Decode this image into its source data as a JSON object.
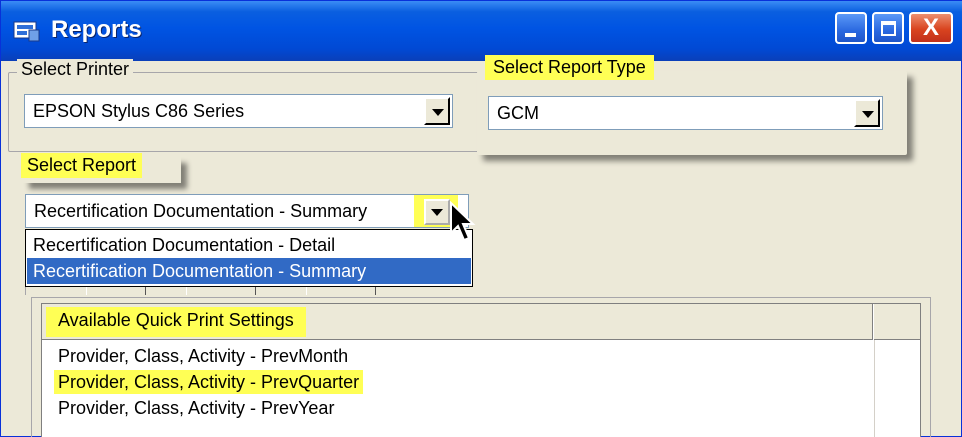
{
  "window": {
    "title": "Reports",
    "close_glyph": "X"
  },
  "printer": {
    "label": "Select Printer",
    "value": "EPSON Stylus C86 Series"
  },
  "report_type": {
    "label": "Select Report Type",
    "value": "GCM"
  },
  "report": {
    "label": "Select Report",
    "value": "Recertification Documentation - Summary",
    "options": [
      "Recertification Documentation - Detail",
      "Recertification Documentation - Summary"
    ]
  },
  "quick_print": {
    "header": "Available Quick Print Settings",
    "rows": [
      "Provider, Class, Activity - PrevMonth",
      "Provider, Class, Activity - PrevQuarter",
      "Provider, Class, Activity - PrevYear"
    ]
  },
  "colors": {
    "highlight": "#ffff55",
    "titlebar": "#0054e3",
    "selection": "#316ac5"
  }
}
